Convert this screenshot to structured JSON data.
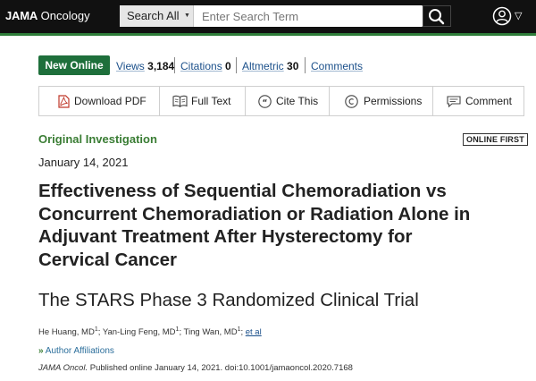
{
  "header": {
    "logo_bold": "JAMA",
    "logo_rest": " Oncology",
    "search_scope": "Search All",
    "search_placeholder": "Enter Search Term"
  },
  "meta": {
    "badge": "New Online",
    "views_label": "Views",
    "views_count": "3,184",
    "citations_label": "Citations",
    "citations_count": "0",
    "altmetric_label": "Altmetric",
    "altmetric_count": "30",
    "comments_label": "Comments"
  },
  "actions": {
    "download_pdf": "Download PDF",
    "full_text": "Full Text",
    "cite_this": "Cite This",
    "permissions": "Permissions",
    "comment": "Comment"
  },
  "article": {
    "type": "Original Investigation",
    "online_first": "ONLINE FIRST",
    "date": "January 14, 2021",
    "title_line1": "Effectiveness of Sequential Chemoradiation vs",
    "title_line2": "Concurrent Chemoradiation or Radiation Alone in",
    "title_line3": "Adjuvant Treatment After Hysterectomy for",
    "title_line4": "Cervical Cancer",
    "subtitle": "The STARS Phase 3 Randomized Clinical Trial",
    "author1": "He Huang, MD",
    "author2": "Yan-Ling Feng, MD",
    "author3": "Ting Wan, MD",
    "sup": "1",
    "et_al": "et al",
    "affiliations": "Author Affiliations",
    "journal": "JAMA Oncol.",
    "citation_rest": " Published online January 14, 2021. doi:10.1001/jamaoncol.2020.7168"
  },
  "colors": {
    "accent_green": "#1e6f3b",
    "topbar": "#111111",
    "link_blue": "#1a4f8a"
  },
  "icons": [
    "search-icon",
    "user-icon",
    "chevron-down-icon",
    "pdf-icon",
    "book-icon",
    "quote-icon",
    "copyright-icon",
    "comment-icon",
    "double-chevron-right-icon"
  ]
}
